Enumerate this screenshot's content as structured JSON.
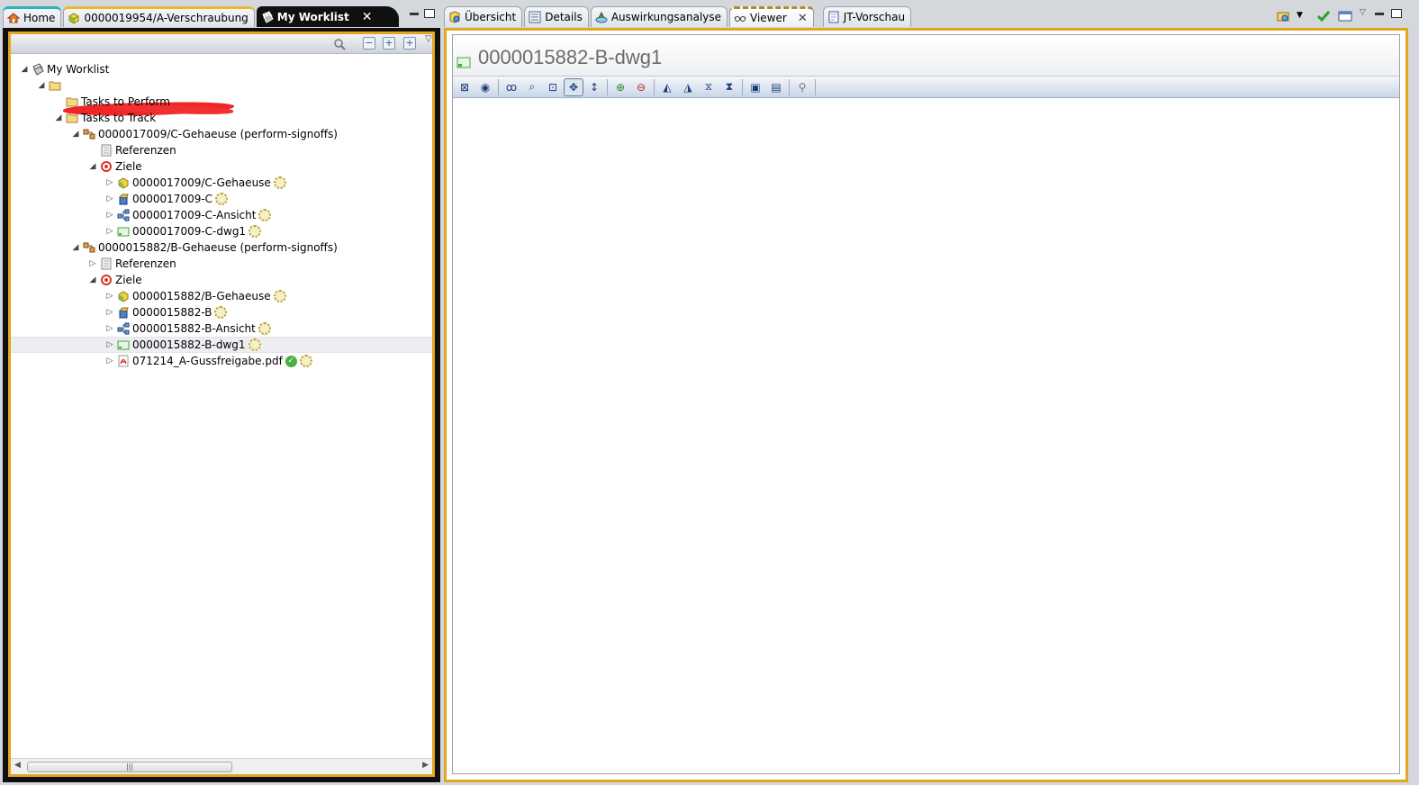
{
  "left_tabs": [
    {
      "label": "Home",
      "icon": "home-icon"
    },
    {
      "label": "0000019954/A-Verschraubung",
      "icon": "item-icon"
    },
    {
      "label": "My Worklist",
      "icon": "worklist-icon"
    }
  ],
  "right_tabs": [
    {
      "label": "Übersicht",
      "icon": "overview-icon"
    },
    {
      "label": "Details",
      "icon": "details-icon"
    },
    {
      "label": "Auswirkungsanalyse",
      "icon": "impact-analysis-icon"
    },
    {
      "label": "Viewer",
      "icon": "glasses-icon"
    },
    {
      "label": "JT-Vorschau",
      "icon": "jt-preview-icon"
    }
  ],
  "tree": {
    "root": "My Worklist",
    "tasks_to_perform": "Tasks to Perform",
    "tasks_to_track": "Tasks to Track",
    "task1": {
      "label": "0000017009/C-Gehaeuse (perform-signoffs)",
      "references": "Referenzen",
      "targets": "Ziele",
      "children": [
        "0000017009/C-Gehaeuse",
        "0000017009-C",
        "0000017009-C-Ansicht",
        "0000017009-C-dwg1"
      ]
    },
    "task2": {
      "label": "0000015882/B-Gehaeuse (perform-signoffs)",
      "references": "Referenzen",
      "targets": "Ziele",
      "children": [
        "0000015882/B-Gehaeuse",
        "0000015882-B",
        "0000015882-B-Ansicht",
        "0000015882-B-dwg1",
        "071214_A-Gussfreigabe.pdf"
      ]
    }
  },
  "scrollbar_grip": "|||",
  "viewer": {
    "title": "0000015882-B-dwg1"
  },
  "colors": {
    "active_border": "#e3a620",
    "dark_tab": "#101010"
  }
}
